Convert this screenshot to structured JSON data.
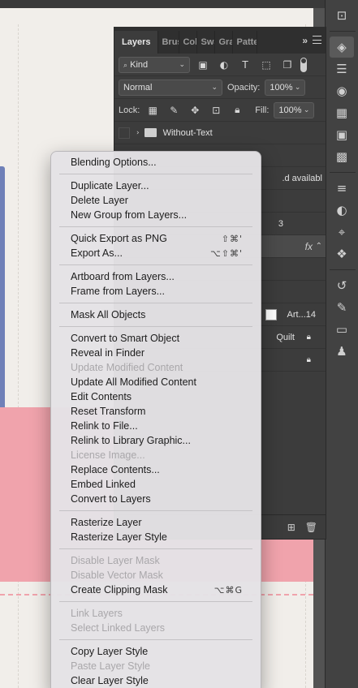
{
  "layers_panel": {
    "tabs": [
      "Layers",
      "Brus",
      "Colo",
      "Swa",
      "Gra",
      "Patte"
    ],
    "filter_kind": "Kind",
    "blend_mode": "Normal",
    "opacity_label": "Opacity:",
    "opacity_value": "100%",
    "lock_label": "Lock:",
    "fill_label": "Fill:",
    "fill_value": "100%",
    "layers": [
      {
        "name": "Without-Text"
      },
      {
        "name": ""
      },
      {
        "name": ".d availabl"
      },
      {
        "name": ""
      },
      {
        "name": "3"
      },
      {
        "name": "fx"
      },
      {
        "name": ""
      },
      {
        "name": ""
      },
      {
        "name": "Art...14"
      },
      {
        "name": "Quilt"
      },
      {
        "name": ""
      }
    ]
  },
  "context_menu": {
    "groups": [
      [
        {
          "label": "Blending Options...",
          "enabled": true
        }
      ],
      [
        {
          "label": "Duplicate Layer...",
          "enabled": true
        },
        {
          "label": "Delete Layer",
          "enabled": true
        },
        {
          "label": "New Group from Layers...",
          "enabled": true
        }
      ],
      [
        {
          "label": "Quick Export as PNG",
          "enabled": true,
          "shortcut": "⇧⌘'"
        },
        {
          "label": "Export As...",
          "enabled": true,
          "shortcut": "⌥⇧⌘'"
        }
      ],
      [
        {
          "label": "Artboard from Layers...",
          "enabled": true
        },
        {
          "label": "Frame from Layers...",
          "enabled": true
        }
      ],
      [
        {
          "label": "Mask All Objects",
          "enabled": true
        }
      ],
      [
        {
          "label": "Convert to Smart Object",
          "enabled": true
        },
        {
          "label": "Reveal in Finder",
          "enabled": true
        },
        {
          "label": "Update Modified Content",
          "enabled": false
        },
        {
          "label": "Update All Modified Content",
          "enabled": true
        },
        {
          "label": "Edit Contents",
          "enabled": true
        },
        {
          "label": "Reset Transform",
          "enabled": true
        },
        {
          "label": "Relink to File...",
          "enabled": true
        },
        {
          "label": "Relink to Library Graphic...",
          "enabled": true
        },
        {
          "label": "License Image...",
          "enabled": false
        },
        {
          "label": "Replace Contents...",
          "enabled": true
        },
        {
          "label": "Embed Linked",
          "enabled": true
        },
        {
          "label": "Convert to Layers",
          "enabled": true
        }
      ],
      [
        {
          "label": "Rasterize Layer",
          "enabled": true
        },
        {
          "label": "Rasterize Layer Style",
          "enabled": true
        }
      ],
      [
        {
          "label": "Disable Layer Mask",
          "enabled": false
        },
        {
          "label": "Disable Vector Mask",
          "enabled": false
        },
        {
          "label": "Create Clipping Mask",
          "enabled": true,
          "shortcut": "⌥⌘G"
        }
      ],
      [
        {
          "label": "Link Layers",
          "enabled": false
        },
        {
          "label": "Select Linked Layers",
          "enabled": false
        }
      ],
      [
        {
          "label": "Copy Layer Style",
          "enabled": true
        },
        {
          "label": "Paste Layer Style",
          "enabled": false
        },
        {
          "label": "Clear Layer Style",
          "enabled": true
        }
      ]
    ]
  },
  "right_toolbar": {
    "icons": [
      "library-icon",
      "layers-icon",
      "properties-icon",
      "color-palette-icon",
      "grid-icon",
      "square-icon",
      "swatches-grid-icon",
      "sliders-icon",
      "adjustments-icon",
      "paths-icon",
      "channels-icon",
      "history-icon",
      "brush-settings-icon",
      "comment-icon",
      "clone-stamp-icon"
    ]
  }
}
